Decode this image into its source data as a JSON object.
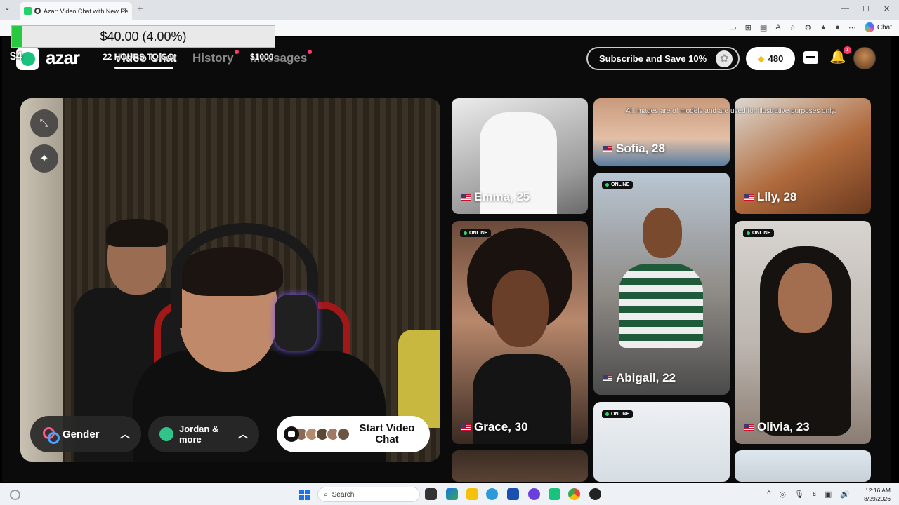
{
  "browser": {
    "tab_title": "Azar: Video Chat with New Pe",
    "tab_close": "×",
    "new_tab": "+",
    "tab_menu": "⌄",
    "window_controls": [
      "—",
      "☐",
      "✕"
    ],
    "chat_label": "Chat",
    "toolbar_icons": [
      "video-icon",
      "grid-icon",
      "page-icon",
      "read-icon",
      "star-icon",
      "extensions-icon",
      "favorites-icon",
      "profile-icon",
      "more-icon"
    ]
  },
  "overlay": {
    "donation_text": "$40.00 (4.00%)",
    "donation_progress": 0.04,
    "hours_text": "22 HOURS TO GO",
    "goal_text": "$1000",
    "dollar_text": "$4"
  },
  "app": {
    "logo": "azar",
    "nav": [
      {
        "label": "Video Chat",
        "active": true
      },
      {
        "label": "History",
        "active": false,
        "dot": true
      },
      {
        "label": "Messages",
        "active": false,
        "dot": true
      }
    ],
    "subscribe_label": "Subscribe and Save 10%",
    "gems": "480",
    "notification_count": "1"
  },
  "camera": {
    "gender_label": "Gender",
    "region_label": "Jordan & more",
    "start_label": "Start Video Chat",
    "chevron": "︿"
  },
  "gallery": {
    "disclaimer": "All images are of models and are used for illustrative purposes only.",
    "online_label": "ONLINE",
    "cards": [
      {
        "name": "Emma, 25",
        "online": false
      },
      {
        "name": "Sofia, 28",
        "online": false
      },
      {
        "name": "Lily, 28",
        "online": false
      },
      {
        "name": "Grace, 30",
        "online": true
      },
      {
        "name": "Abigail, 22",
        "online": true
      },
      {
        "name": "Olivia, 23",
        "online": true
      }
    ]
  },
  "taskbar": {
    "search_placeholder": "Search",
    "time": "12:16 AM",
    "date": "8/29/2026"
  },
  "colors": {
    "accent_green": "#19c37d",
    "online_dot": "#2fd36b",
    "notif_red": "#ff3b6a",
    "donation_fill": "#28c840"
  }
}
